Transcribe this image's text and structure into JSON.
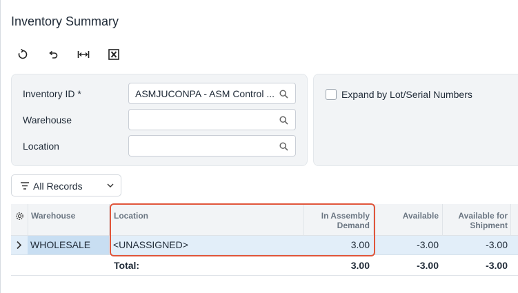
{
  "page": {
    "title": "Inventory Summary"
  },
  "toolbar": {
    "buttons": [
      {
        "icon": "refresh-icon"
      },
      {
        "icon": "undo-icon"
      },
      {
        "icon": "fit-columns-icon"
      },
      {
        "icon": "excel-export-icon"
      }
    ]
  },
  "form": {
    "inventory_id": {
      "label": "Inventory ID *",
      "value": "ASMJUCONPA - ASM Control ..."
    },
    "warehouse": {
      "label": "Warehouse",
      "value": ""
    },
    "location": {
      "label": "Location",
      "value": ""
    },
    "expand_lot_serial": {
      "label": "Expand by Lot/Serial Numbers",
      "checked": false
    }
  },
  "filter": {
    "label": "All Records"
  },
  "grid": {
    "columns": [
      "Warehouse",
      "Location",
      "In Assembly Demand",
      "Available",
      "Available for Shipment"
    ],
    "rows": [
      {
        "warehouse": "WHOLESALE",
        "location": "<UNASSIGNED>",
        "in_assembly_demand": "3.00",
        "available": "-3.00",
        "available_for_shipment": "-3.00"
      }
    ],
    "total": {
      "label": "Total:",
      "in_assembly_demand": "3.00",
      "available": "-3.00",
      "available_for_shipment": "-3.00"
    }
  },
  "colors": {
    "highlight": "#e0553a",
    "selected_row": "#e2eef9",
    "selected_cell": "#c8def2",
    "panel_bg": "#f2f4f6"
  }
}
